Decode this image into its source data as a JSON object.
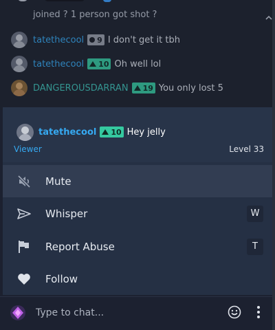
{
  "chat": {
    "partial_message": "joined ? 1 person got shot ?",
    "messages": [
      {
        "username": "tatethecool",
        "badge": "9",
        "badge_style": "grey",
        "text": "I don't get it tbh",
        "avatar": "grey"
      },
      {
        "username": "tatethecool",
        "badge": "10",
        "badge_style": "green",
        "text": "Oh well lol",
        "avatar": "grey"
      },
      {
        "username": "DANGEROUSDARRAN",
        "badge": "19",
        "badge_style": "green",
        "text": "You only lost 5",
        "avatar": "orange"
      }
    ]
  },
  "popup": {
    "username": "tatethecool",
    "badge": "10",
    "message": "Hey jelly",
    "role": "Viewer",
    "level": "Level 33",
    "menu": [
      {
        "label": "Mute",
        "icon": "mute-icon",
        "shortcut": ""
      },
      {
        "label": "Whisper",
        "icon": "send-icon",
        "shortcut": "W"
      },
      {
        "label": "Report Abuse",
        "icon": "flag-icon",
        "shortcut": "T"
      },
      {
        "label": "Follow",
        "icon": "heart-icon",
        "shortcut": ""
      }
    ]
  },
  "input": {
    "placeholder": "Type to chat..."
  },
  "colors": {
    "username_blue": "#36a9f1",
    "badge_green": "#35c9a0",
    "popup_bg": "#253044",
    "active_row": "#323d52"
  }
}
